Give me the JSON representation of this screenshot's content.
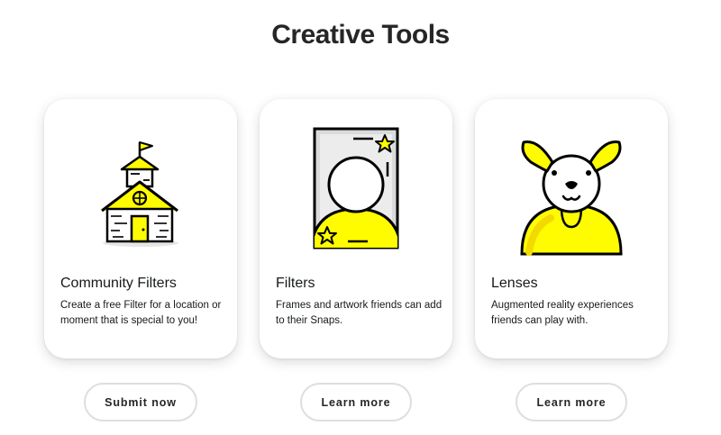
{
  "page": {
    "title": "Creative Tools"
  },
  "cards": [
    {
      "title": "Community Filters",
      "description": "Create a free Filter for a location or moment that is special to you!",
      "icon": "schoolhouse-icon",
      "button_label": "Submit now"
    },
    {
      "title": "Filters",
      "description": "Frames and artwork friends can add to their Snaps.",
      "icon": "photo-frame-icon",
      "button_label": "Learn more"
    },
    {
      "title": "Lenses",
      "description": "Augmented reality experiences friends can play with.",
      "icon": "dog-lens-icon",
      "button_label": "Learn more"
    }
  ],
  "colors": {
    "accent_yellow": "#fffc00",
    "outline": "#000000",
    "text": "#16191c"
  }
}
